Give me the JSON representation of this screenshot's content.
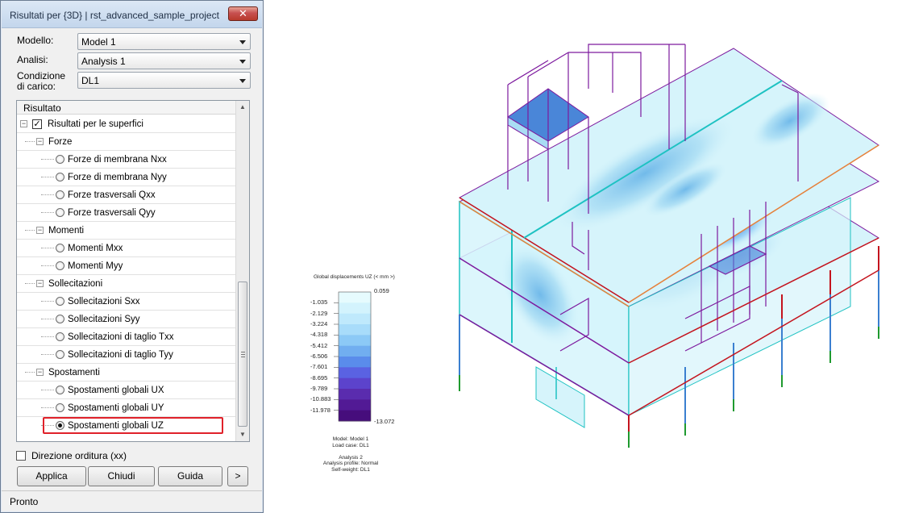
{
  "window": {
    "title": "Risultati per {3D} | rst_advanced_sample_project",
    "close_glyph": "✕"
  },
  "form": {
    "model_label": "Modello:",
    "model_value": "Model 1",
    "analysis_label": "Analisi:",
    "analysis_value": "Analysis 1",
    "loadcase_label": "Condizione di carico:",
    "loadcase_value": "DL1"
  },
  "tree": {
    "header": "Risultato",
    "root": {
      "label": "Risultati per le superfici",
      "checked": true
    },
    "groups": [
      {
        "label": "Forze",
        "items": [
          "Forze di membrana Nxx",
          "Forze di membrana Nyy",
          "Forze trasversali Qxx",
          "Forze trasversali Qyy"
        ]
      },
      {
        "label": "Momenti",
        "items": [
          "Momenti Mxx",
          "Momenti Myy"
        ]
      },
      {
        "label": "Sollecitazioni",
        "items": [
          "Sollecitazioni Sxx",
          "Sollecitazioni Syy",
          "Sollecitazioni di taglio Txx",
          "Sollecitazioni di taglio Tyy"
        ]
      },
      {
        "label": "Spostamenti",
        "items": [
          "Spostamenti globali UX",
          "Spostamenti globali UY",
          "Spostamenti globali UZ"
        ]
      }
    ],
    "selected_item": "Spostamenti globali UZ"
  },
  "options": {
    "direction_label": "Direzione orditura (xx)",
    "direction_checked": false
  },
  "buttons": {
    "apply": "Applica",
    "close": "Chiudi",
    "help": "Guida",
    "more": ">"
  },
  "status": "Pronto",
  "legend": {
    "title": "Global displacements UZ (< mm >)",
    "top_value": "0.059",
    "bottom_value": "-13.072",
    "ticks": [
      "-1.035",
      "-2.129",
      "-3.224",
      "-4.318",
      "-5.412",
      "-6.506",
      "-7.601",
      "-8.695",
      "-9.789",
      "-10.883",
      "-11.978"
    ],
    "colors": [
      "#e6fbfe",
      "#d3f3fd",
      "#bfe9fc",
      "#a8dcfa",
      "#8cc9f6",
      "#71aef0",
      "#5a8ceb",
      "#5a62e2",
      "#5c43cc",
      "#5a2cae",
      "#521a95",
      "#460d7c"
    ],
    "info_lines": [
      "Model: Model 1",
      "Load case: DL1",
      "",
      "Analysis 2",
      "Analysis profile: Normal",
      "Self-weight: DL1"
    ]
  },
  "model_colors": {
    "slab_light": "#d6f4fb",
    "slab_mid": "#a9ddf4",
    "slab_dark": "#6cb7e9",
    "slab_deep": "#4a86d8",
    "beam_cyan": "#1ec2c2",
    "beam_purple": "#7d1a9e",
    "column_red": "#c4141e",
    "column_green": "#1f9a2f",
    "column_blue": "#3a7fd0",
    "beam_orange": "#e6823a"
  }
}
